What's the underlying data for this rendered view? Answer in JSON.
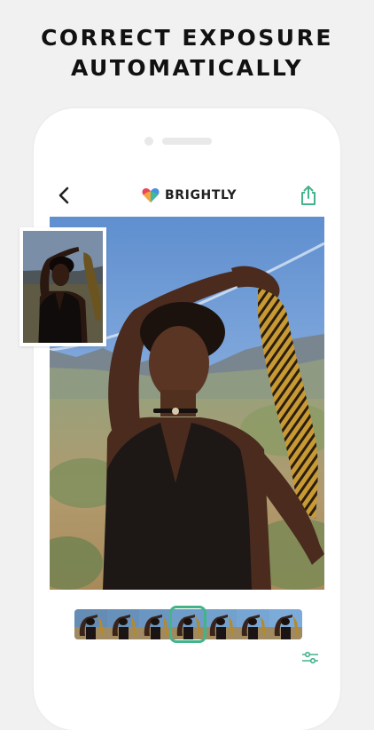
{
  "marketing": {
    "headline_line1": "CORRECT EXPOSURE",
    "headline_line2": "AUTOMATICALLY"
  },
  "app": {
    "brand_name": "BRIGHTLY",
    "logo_colors": [
      "#e8455b",
      "#f6b93b",
      "#3ec18f",
      "#4a8fe0"
    ],
    "accent_color": "#43b48a"
  },
  "toolbar": {
    "back_icon": "chevron-left-icon",
    "share_icon": "share-icon"
  },
  "editor": {
    "main_image": "edited-portrait",
    "before_thumbnail": "original-portrait",
    "filmstrip_frames": 7,
    "selected_frame_index": 3,
    "adjust_icon": "sliders-icon"
  }
}
